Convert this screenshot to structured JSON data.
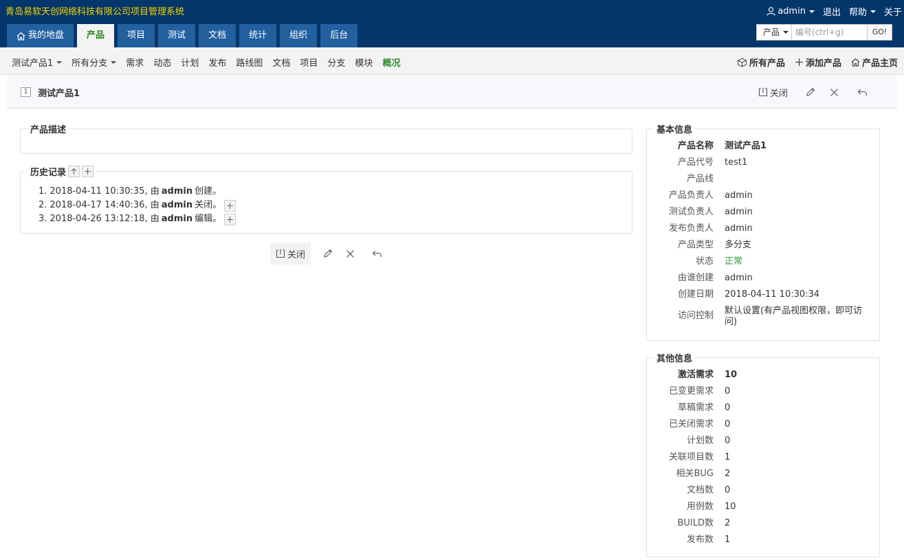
{
  "header": {
    "company": "青岛易软天创网络科技有限公司项目管理系统",
    "user": "admin",
    "logout": "退出",
    "help": "帮助",
    "about": "关于"
  },
  "mainnav": [
    {
      "label": "我的地盘",
      "icon": "home-icon"
    },
    {
      "label": "产品",
      "active": true
    },
    {
      "label": "项目"
    },
    {
      "label": "测试"
    },
    {
      "label": "文档"
    },
    {
      "label": "统计"
    },
    {
      "label": "组织"
    },
    {
      "label": "后台"
    }
  ],
  "search": {
    "type": "产品",
    "placeholder": "编号(ctrl+g)",
    "go": "GO!"
  },
  "subnav": {
    "product_selector": "测试产品1",
    "branch_selector": "所有分支",
    "items": [
      "需求",
      "动态",
      "计划",
      "发布",
      "路线图",
      "文档",
      "项目",
      "分支",
      "模块",
      "概况"
    ],
    "current": "概况",
    "right": {
      "all_products": "所有产品",
      "add_product": "添加产品",
      "product_home": "产品主页"
    }
  },
  "title": {
    "id": "1",
    "name": "测试产品1",
    "close_label": "关闭"
  },
  "description": {
    "legend": "产品描述",
    "content": ""
  },
  "history": {
    "legend": "历史记录",
    "entries": [
      {
        "index": "1.",
        "time": "2018-04-11 10:30:35, 由",
        "user": "admin",
        "action": "创建。",
        "expandable": false
      },
      {
        "index": "2.",
        "time": "2018-04-17 14:40:36, 由",
        "user": "admin",
        "action": "关闭。",
        "expandable": true
      },
      {
        "index": "3.",
        "time": "2018-04-26 13:12:18, 由",
        "user": "admin",
        "action": "编辑。",
        "expandable": true
      }
    ]
  },
  "bottom_actions": {
    "close_label": "关闭"
  },
  "basic_info": {
    "legend": "基本信息",
    "rows": [
      {
        "k": "产品名称",
        "v": "测试产品1",
        "bold": true
      },
      {
        "k": "产品代号",
        "v": "test1"
      },
      {
        "k": "产品线",
        "v": ""
      },
      {
        "k": "产品负责人",
        "v": "admin"
      },
      {
        "k": "测试负责人",
        "v": "admin"
      },
      {
        "k": "发布负责人",
        "v": "admin"
      },
      {
        "k": "产品类型",
        "v": "多分支"
      },
      {
        "k": "状态",
        "v": "正常",
        "status": "ok"
      },
      {
        "k": "由谁创建",
        "v": "admin"
      },
      {
        "k": "创建日期",
        "v": "2018-04-11 10:30:34"
      },
      {
        "k": "访问控制",
        "v": "默认设置(有产品视图权限，即可访问)",
        "wrap": true
      }
    ]
  },
  "other_info": {
    "legend": "其他信息",
    "rows": [
      {
        "k": "激活需求",
        "v": "10",
        "bold": true
      },
      {
        "k": "已变更需求",
        "v": "0"
      },
      {
        "k": "草稿需求",
        "v": "0"
      },
      {
        "k": "已关闭需求",
        "v": "0"
      },
      {
        "k": "计划数",
        "v": "0"
      },
      {
        "k": "关联项目数",
        "v": "1"
      },
      {
        "k": "相关BUG",
        "v": "2"
      },
      {
        "k": "文档数",
        "v": "0"
      },
      {
        "k": "用例数",
        "v": "10"
      },
      {
        "k": "BUILD数",
        "v": "2"
      },
      {
        "k": "发布数",
        "v": "1"
      }
    ]
  },
  "colors": {
    "header_bg": "#03366a",
    "tab_bg": "#2260a0",
    "active_text": "#2e7d20",
    "company_text": "#f5d300",
    "status_ok": "#2e9b3a"
  }
}
